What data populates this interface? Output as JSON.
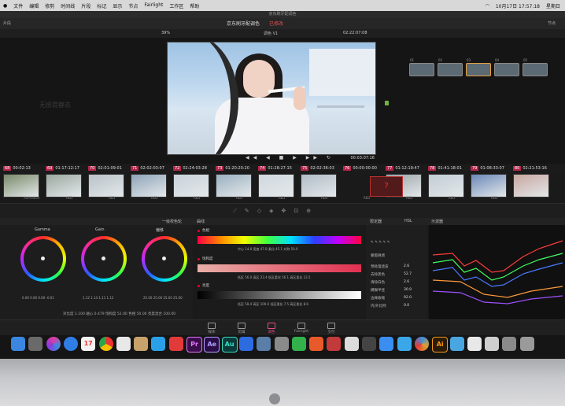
{
  "menubar": {
    "items": [
      "文件",
      "编辑",
      "修剪",
      "时间线",
      "片段",
      "标记",
      "显示",
      "节点",
      "Fairlight",
      "工作区",
      "帮助"
    ],
    "right_date": "10月17日 17:57:18",
    "right_day": "星期日"
  },
  "window_title": "京东刷牙配调色",
  "toolbar": {
    "left": "片段",
    "project_name": "京东刷牙配调色",
    "edited_status": "已修改",
    "right": "节点"
  },
  "subbar": {
    "zoom": "39%",
    "clip_name": "调色 V1",
    "timecode": "02:22:07:08"
  },
  "viewer": {
    "timecode": "00:03:07:16",
    "transport": "◀◀ ◀ ■ ▶ ▶▶ ↻"
  },
  "side_watermark": "无损提静态",
  "nodes": [
    {
      "label": "01"
    },
    {
      "label": "02"
    },
    {
      "label": "03"
    },
    {
      "label": "04"
    },
    {
      "label": "05"
    }
  ],
  "timeline": {
    "clips": [
      {
        "num": "68",
        "tc": "00:02:13"
      },
      {
        "num": "69",
        "tc": "01:17:12:17"
      },
      {
        "num": "70",
        "tc": "02:01:09:01"
      },
      {
        "num": "71",
        "tc": "02:02:03:07"
      },
      {
        "num": "72",
        "tc": "02:24:03:28"
      },
      {
        "num": "73",
        "tc": "01:20:20:20"
      },
      {
        "num": "74",
        "tc": "01:28:27:15"
      },
      {
        "num": "75",
        "tc": "02:02:36:03"
      },
      {
        "num": "76",
        "tc": "00:00:00:00"
      },
      {
        "num": "77",
        "tc": "01:12:19:47"
      },
      {
        "num": "78",
        "tc": "01:41:18:01"
      },
      {
        "num": "79",
        "tc": "01:08:33:07"
      },
      {
        "num": "80",
        "tc": "02:21:53:16"
      }
    ],
    "labels": [
      "Animation",
      "RED",
      "RED",
      "RED",
      "RED",
      "RED",
      "RED",
      "RED",
      "RED",
      "RED",
      "RED",
      "RED"
    ],
    "missing_clip": "?"
  },
  "panels": {
    "color_wheels_title": "一级校色轮",
    "hsl_title": "曲线",
    "qualifier_title": "限定器",
    "hsl_mode": "HSL",
    "scope_title": "示波器"
  },
  "wheels": [
    {
      "label": "Gamma",
      "vals": "0.00  0.00  0.00  -0.01"
    },
    {
      "label": "Gain",
      "vals": "1.12  1.14  1.11  1.12"
    },
    {
      "label": "偏移",
      "vals": "25.00  25.00  25.00  25.00"
    }
  ],
  "wheel_footer": "对比度 1.100    轴心 0.479    饱和度 52.00    色相 50.00    亮度混合 100.00",
  "hsl_bars": [
    {
      "title": "色相",
      "vals": "中心 14.8    宽度 47.8    柔化 45.1    对称 50.0"
    },
    {
      "title": "饱和度",
      "vals": "低区 56.0    高区 23.4    低区柔化 56.1    高区柔化 23.5"
    },
    {
      "title": "亮度",
      "vals": "低区 58.4    高区 100.0    低区柔化 7.5    高区柔化 8.6"
    }
  ],
  "qualifier": {
    "section": "蒙版微调",
    "rows": [
      {
        "k": "预处理滤波",
        "v": "2.6"
      },
      {
        "k": "去除黑色",
        "v": "52.7"
      },
      {
        "k": "清除白色",
        "v": "2.6"
      },
      {
        "k": "模糊半径",
        "v": "30.9"
      },
      {
        "k": "边缘收缩",
        "v": "92.0"
      },
      {
        "k": "内/外比例",
        "v": "0.0"
      }
    ]
  },
  "pages": [
    {
      "label": "媒体"
    },
    {
      "label": "剪辑"
    },
    {
      "label": "调色"
    },
    {
      "label": "Fairlight"
    },
    {
      "label": "交付"
    }
  ],
  "dock_icons": [
    {
      "name": "finder",
      "color": "#3a86e0",
      "txt": ""
    },
    {
      "name": "launchpad",
      "color": "#6a6a6a",
      "txt": ""
    },
    {
      "name": "siri",
      "color": "#7a4ad8",
      "txt": ""
    },
    {
      "name": "safari",
      "color": "#2f7ee6",
      "txt": ""
    },
    {
      "name": "calendar",
      "color": "#f2f2f2",
      "txt": "17"
    },
    {
      "name": "chrome",
      "color": "#e6e6e6",
      "txt": ""
    },
    {
      "name": "photos",
      "color": "#e8e8e8",
      "txt": ""
    },
    {
      "name": "preview",
      "color": "#c7a26a",
      "txt": ""
    },
    {
      "name": "qq",
      "color": "#2aa0e8",
      "txt": ""
    },
    {
      "name": "jd",
      "color": "#e23a3a",
      "txt": ""
    },
    {
      "name": "photoshop-pr",
      "color": "#3a0e4a",
      "txt": "Pr"
    },
    {
      "name": "after-effects",
      "color": "#2a0d46",
      "txt": "Ae"
    },
    {
      "name": "audition",
      "color": "#0b3a3a",
      "txt": "Au"
    },
    {
      "name": "baidu-netdisk",
      "color": "#2d6be0",
      "txt": ""
    },
    {
      "name": "app-a",
      "color": "#5a7ea8",
      "txt": ""
    },
    {
      "name": "system-preferences",
      "color": "#8a8a8a",
      "txt": ""
    },
    {
      "name": "wechat",
      "color": "#33b14a",
      "txt": ""
    },
    {
      "name": "wps",
      "color": "#e85a2a",
      "txt": ""
    },
    {
      "name": "app-b",
      "color": "#c23a3a",
      "txt": ""
    },
    {
      "name": "app-c",
      "color": "#dcdcdc",
      "txt": ""
    },
    {
      "name": "motion",
      "color": "#444",
      "txt": ""
    },
    {
      "name": "feishu",
      "color": "#3a8ef0",
      "txt": ""
    },
    {
      "name": "app-d",
      "color": "#3aa8e8",
      "txt": ""
    },
    {
      "name": "davinci",
      "color": "#2a2a2a",
      "txt": ""
    },
    {
      "name": "illustrator",
      "color": "#2a1a08",
      "txt": "Ai"
    },
    {
      "name": "folder",
      "color": "#4aa6e0",
      "txt": ""
    },
    {
      "name": "doc-1",
      "color": "#e8e8e8",
      "txt": ""
    },
    {
      "name": "doc-2",
      "color": "#cfcfcf",
      "txt": ""
    },
    {
      "name": "doc-3",
      "color": "#8a8a8a",
      "txt": ""
    },
    {
      "name": "trash",
      "color": "#9a9a9a",
      "txt": ""
    }
  ]
}
